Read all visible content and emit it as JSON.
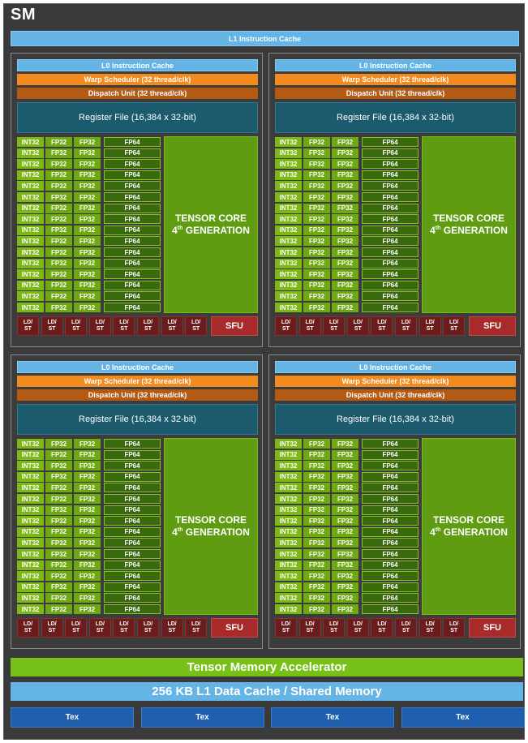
{
  "sm_label": "SM",
  "l1_instruction_cache": "L1 Instruction Cache",
  "subpartition": {
    "l0_cache": "L0 Instruction Cache",
    "warp_scheduler": "Warp Scheduler (32 thread/clk)",
    "dispatch_unit": "Dispatch Unit (32 thread/clk)",
    "register_file": "Register File (16,384 x 32-bit)",
    "int32": "INT32",
    "fp32": "FP32",
    "fp64": "FP64",
    "tensor_core_line1": "TENSOR CORE",
    "tensor_core_gen_num": "4",
    "tensor_core_gen_sup": "th",
    "tensor_core_gen_word": "GENERATION",
    "ldst_line1": "LD/",
    "ldst_line2": "ST",
    "sfu": "SFU",
    "rows": 16,
    "ldst_count": 8
  },
  "subpartition_count": 4,
  "tensor_memory_accelerator": "Tensor Memory Accelerator",
  "l1_data_cache": "256 KB L1 Data Cache / Shared Memory",
  "tex_units": [
    "Tex",
    "Tex",
    "Tex",
    "Tex"
  ],
  "colors": {
    "background": "#3a3a3a",
    "cache_blue": "#64b4e6",
    "warp_orange": "#f28a1e",
    "dispatch_brown": "#b35a15",
    "register_teal": "#1c5a6e",
    "int32_green": "#7db817",
    "fp64_dark_green": "#3a6a0e",
    "ldst_red": "#6b1c1c",
    "sfu_red": "#a82a2a",
    "tex_blue": "#1f5fae"
  }
}
